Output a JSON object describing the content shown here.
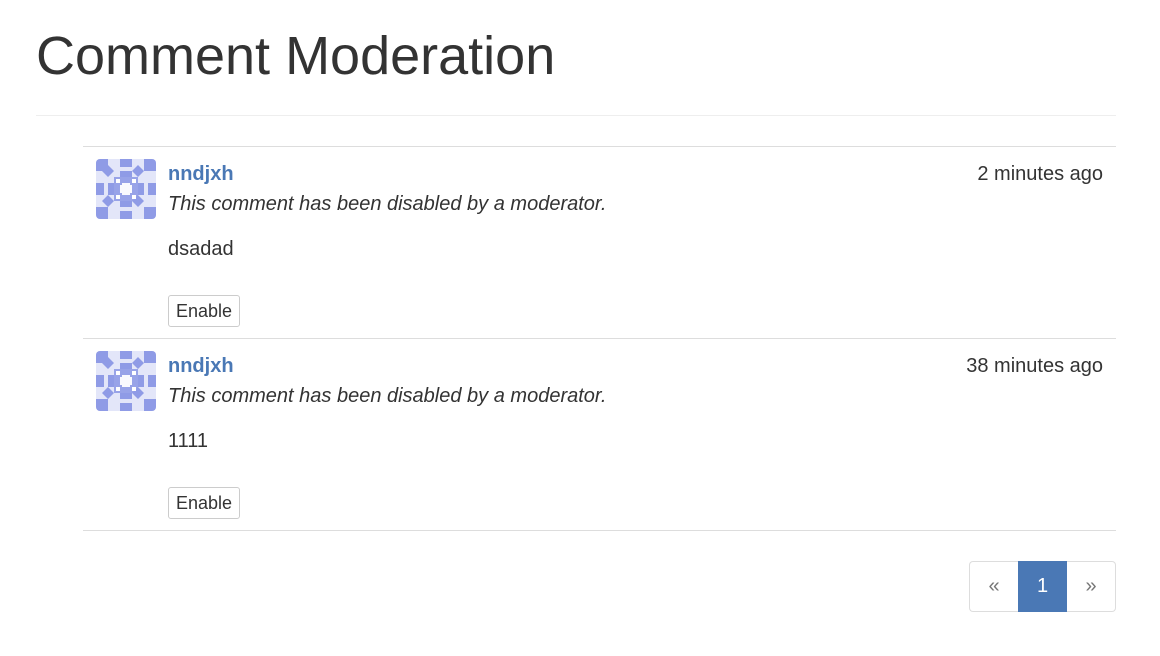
{
  "page": {
    "title": "Comment Moderation"
  },
  "comments": [
    {
      "author": "nndjxh",
      "time": "2 minutes ago",
      "status_note": "This comment has been disabled by a moderator.",
      "body": "dsadad",
      "action_label": "Enable",
      "avatar_icon": "identicon"
    },
    {
      "author": "nndjxh",
      "time": "38 minutes ago",
      "status_note": "This comment has been disabled by a moderator.",
      "body": "1111",
      "action_label": "Enable",
      "avatar_icon": "identicon"
    }
  ],
  "pagination": {
    "prev": "«",
    "current": "1",
    "next": "»"
  },
  "colors": {
    "link": "#4a78b5",
    "active_page": "#4a78b5",
    "avatar": "#8f9be6"
  }
}
